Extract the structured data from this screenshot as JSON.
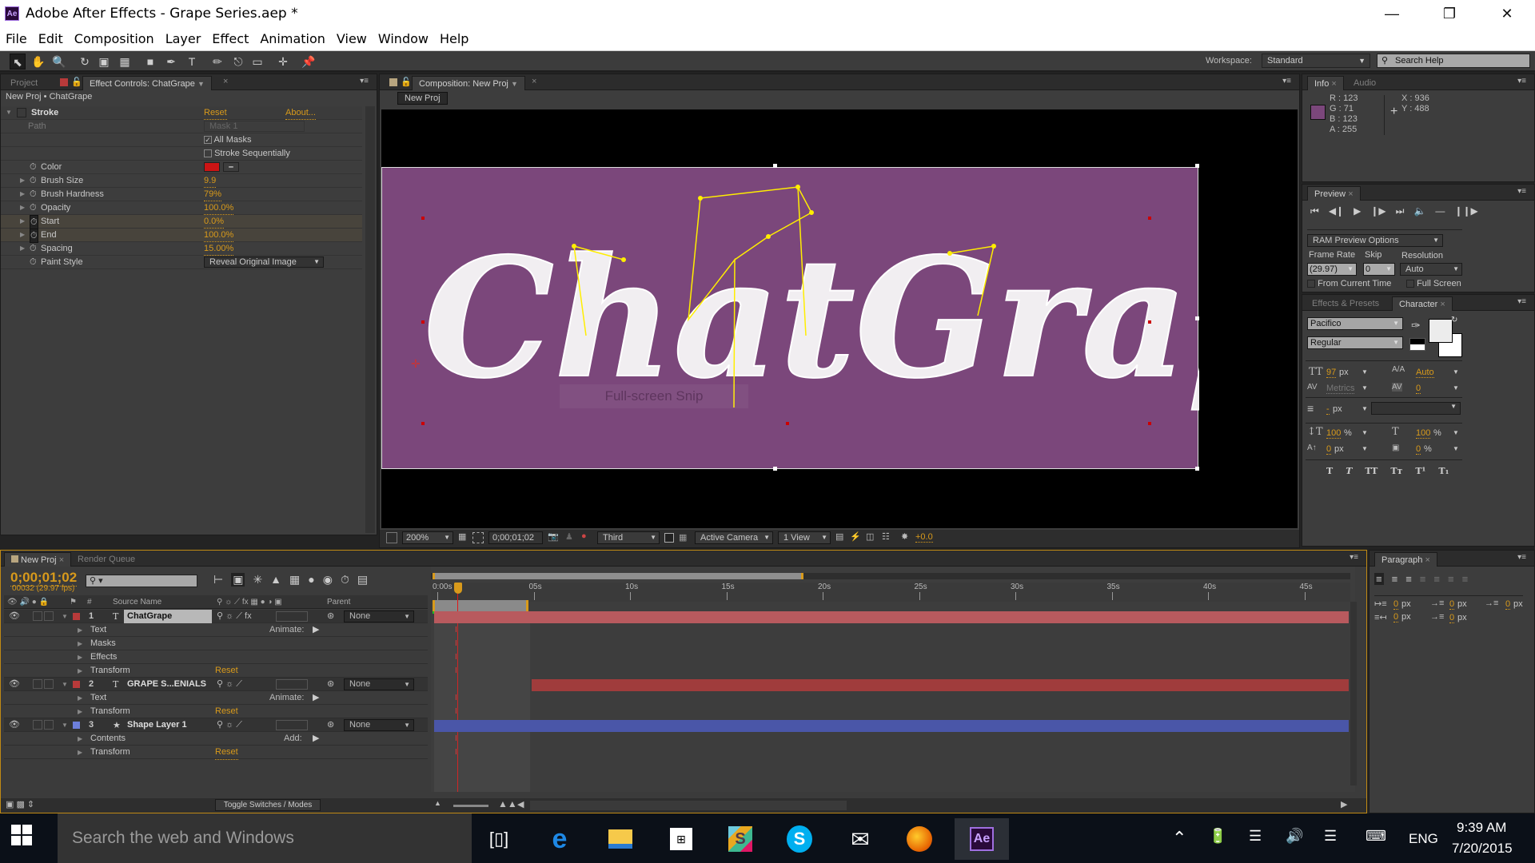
{
  "window": {
    "app_icon": "Ae",
    "title": "Adobe After Effects - Grape Series.aep *",
    "controls": [
      "minimize",
      "maximize",
      "close"
    ]
  },
  "menu": [
    "File",
    "Edit",
    "Composition",
    "Layer",
    "Effect",
    "Animation",
    "View",
    "Window",
    "Help"
  ],
  "toolbar": {
    "tools": [
      "selection-tool",
      "hand-tool",
      "zoom-tool",
      "rotation-tool",
      "camera-tool",
      "pan-behind-tool",
      "rectangle-tool",
      "pen-tool",
      "type-tool",
      "brush-tool",
      "clone-stamp-tool",
      "eraser-tool",
      "roto-brush-tool",
      "puppet-pin-tool"
    ],
    "workspace_label": "Workspace:",
    "workspace_value": "Standard",
    "search_help": "Search Help"
  },
  "left_panel": {
    "tabs": [
      "Project",
      "Effect Controls: ChatGrape"
    ],
    "breadcrumb": "New Proj • ChatGrape",
    "effect": {
      "name": "Stroke",
      "reset": "Reset",
      "about": "About...",
      "path_label": "Path",
      "path_value": "Mask 1",
      "all_masks": "All Masks",
      "all_masks_checked": true,
      "stroke_sequentially": "Stroke Sequentially",
      "stroke_sequentially_checked": false,
      "color_label": "Color",
      "color_value": "#cc1414",
      "properties": [
        {
          "label": "Brush Size",
          "value": "9.9"
        },
        {
          "label": "Brush Hardness",
          "value": "79%"
        },
        {
          "label": "Opacity",
          "value": "100.0%"
        },
        {
          "label": "Start",
          "value": "0.0%",
          "keyframed": true
        },
        {
          "label": "End",
          "value": "100.0%",
          "keyframed": true
        },
        {
          "label": "Spacing",
          "value": "15.00%"
        }
      ],
      "paint_style_label": "Paint Style",
      "paint_style_value": "Reveal Original Image"
    }
  },
  "composition": {
    "tab": "Composition: New Proj",
    "breadcrumb": "New Proj",
    "text": "ChatGrape",
    "bg_color": "#7b477b",
    "snip_overlay": "Full-screen Snip",
    "footer": {
      "zoom": "200%",
      "timecode": "0;00;01;02",
      "resolution": "Third",
      "camera": "Active Camera",
      "views": "1 View",
      "exposure": "+0.0"
    }
  },
  "info": {
    "tabs": [
      "Info",
      "Audio"
    ],
    "r": "R : 123",
    "g": "G : 71",
    "b": "B : 123",
    "a": "A : 255",
    "swatch": "#7b477b",
    "x": "X : 936",
    "y": "Y : 488"
  },
  "preview": {
    "tab": "Preview",
    "ram_options": "RAM Preview Options",
    "frame_rate_label": "Frame Rate",
    "frame_rate": "(29.97)",
    "skip_label": "Skip",
    "skip": "0",
    "resolution_label": "Resolution",
    "resolution": "Auto",
    "from_current": "From Current Time",
    "full_screen": "Full Screen"
  },
  "character": {
    "tabs": [
      "Effects & Presets",
      "Character"
    ],
    "font": "Pacifico",
    "style": "Regular",
    "size": "97",
    "size_unit": "px",
    "leading": "Auto",
    "kerning": "Metrics",
    "tracking": "0",
    "stroke_width": "-",
    "stroke_unit": "px",
    "vscale": "100",
    "hscale": "100",
    "baseline": "0",
    "tsume": "0",
    "pct": "%",
    "px": "px",
    "styles": [
      "T",
      "T",
      "TT",
      "Tт",
      "T¹",
      "T₁"
    ]
  },
  "paragraph": {
    "tab": "Paragraph",
    "indents": [
      "0",
      "0",
      "0",
      "0",
      "0"
    ],
    "unit": "px"
  },
  "timeline": {
    "tabs": [
      "New Proj",
      "Render Queue"
    ],
    "timecode": "0;00;01;02",
    "frame_info": "00032 (29.97 fps)",
    "columns": {
      "num": "#",
      "source": "Source Name",
      "parent": "Parent"
    },
    "ticks": [
      "0:00s",
      "05s",
      "10s",
      "15s",
      "20s",
      "25s",
      "30s",
      "35s",
      "40s",
      "45s"
    ],
    "layers": [
      {
        "num": "1",
        "name": "ChatGrape",
        "type": "text",
        "color": "#b83a3a",
        "parent": "None",
        "bar_color": "#b85a5e",
        "props": [
          {
            "name": "Text",
            "extra": "Animate:"
          },
          {
            "name": "Masks"
          },
          {
            "name": "Effects"
          },
          {
            "name": "Transform",
            "extra": "Reset"
          }
        ]
      },
      {
        "num": "2",
        "name": "GRAPE S...ENIALS",
        "type": "text",
        "color": "#b83a3a",
        "parent": "None",
        "bar_color": "#a03c3c",
        "props": [
          {
            "name": "Text",
            "extra": "Animate:"
          },
          {
            "name": "Transform",
            "extra": "Reset"
          }
        ]
      },
      {
        "num": "3",
        "name": "Shape Layer 1",
        "type": "shape",
        "color": "#6d7fdb",
        "parent": "None",
        "bar_color": "#4a56a8",
        "props": [
          {
            "name": "Contents",
            "extra": "Add:"
          },
          {
            "name": "Transform",
            "extra": "Reset"
          }
        ]
      }
    ],
    "toggle": "Toggle Switches / Modes"
  },
  "taskbar": {
    "search": "Search the web and Windows",
    "apps": [
      "task-view",
      "edge",
      "file-explorer",
      "store",
      "slack",
      "skype",
      "mail",
      "firefox",
      "after-effects"
    ],
    "lang": "ENG",
    "time": "9:39 AM",
    "date": "7/20/2015"
  }
}
